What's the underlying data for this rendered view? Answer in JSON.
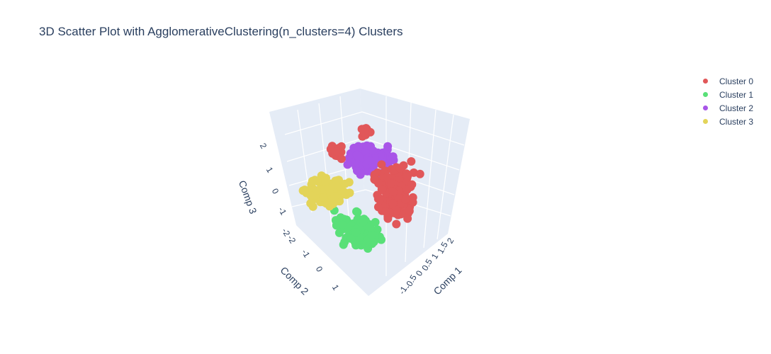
{
  "chart_data": {
    "type": "scatter",
    "title": "3D Scatter Plot with AgglomerativeClustering(n_clusters=4) Clusters",
    "axes": {
      "x": {
        "label": "Comp 1",
        "ticks": [
          "-1",
          "-0.5",
          "0",
          "0.5",
          "1",
          "1.5",
          "2"
        ]
      },
      "y": {
        "label": "Comp 2",
        "ticks": [
          "-2",
          "-1",
          "0",
          "1"
        ]
      },
      "z": {
        "label": "Comp 3",
        "ticks": [
          "-2",
          "-1",
          "0",
          "1",
          "2"
        ]
      }
    },
    "grid": true,
    "legend_position": "top-right",
    "series": [
      {
        "name": "Cluster 0",
        "color": "#e15759"
      },
      {
        "name": "Cluster 1",
        "color": "#59e078"
      },
      {
        "name": "Cluster 2",
        "color": "#a855e8"
      },
      {
        "name": "Cluster 3",
        "color": "#e3d459"
      }
    ]
  }
}
